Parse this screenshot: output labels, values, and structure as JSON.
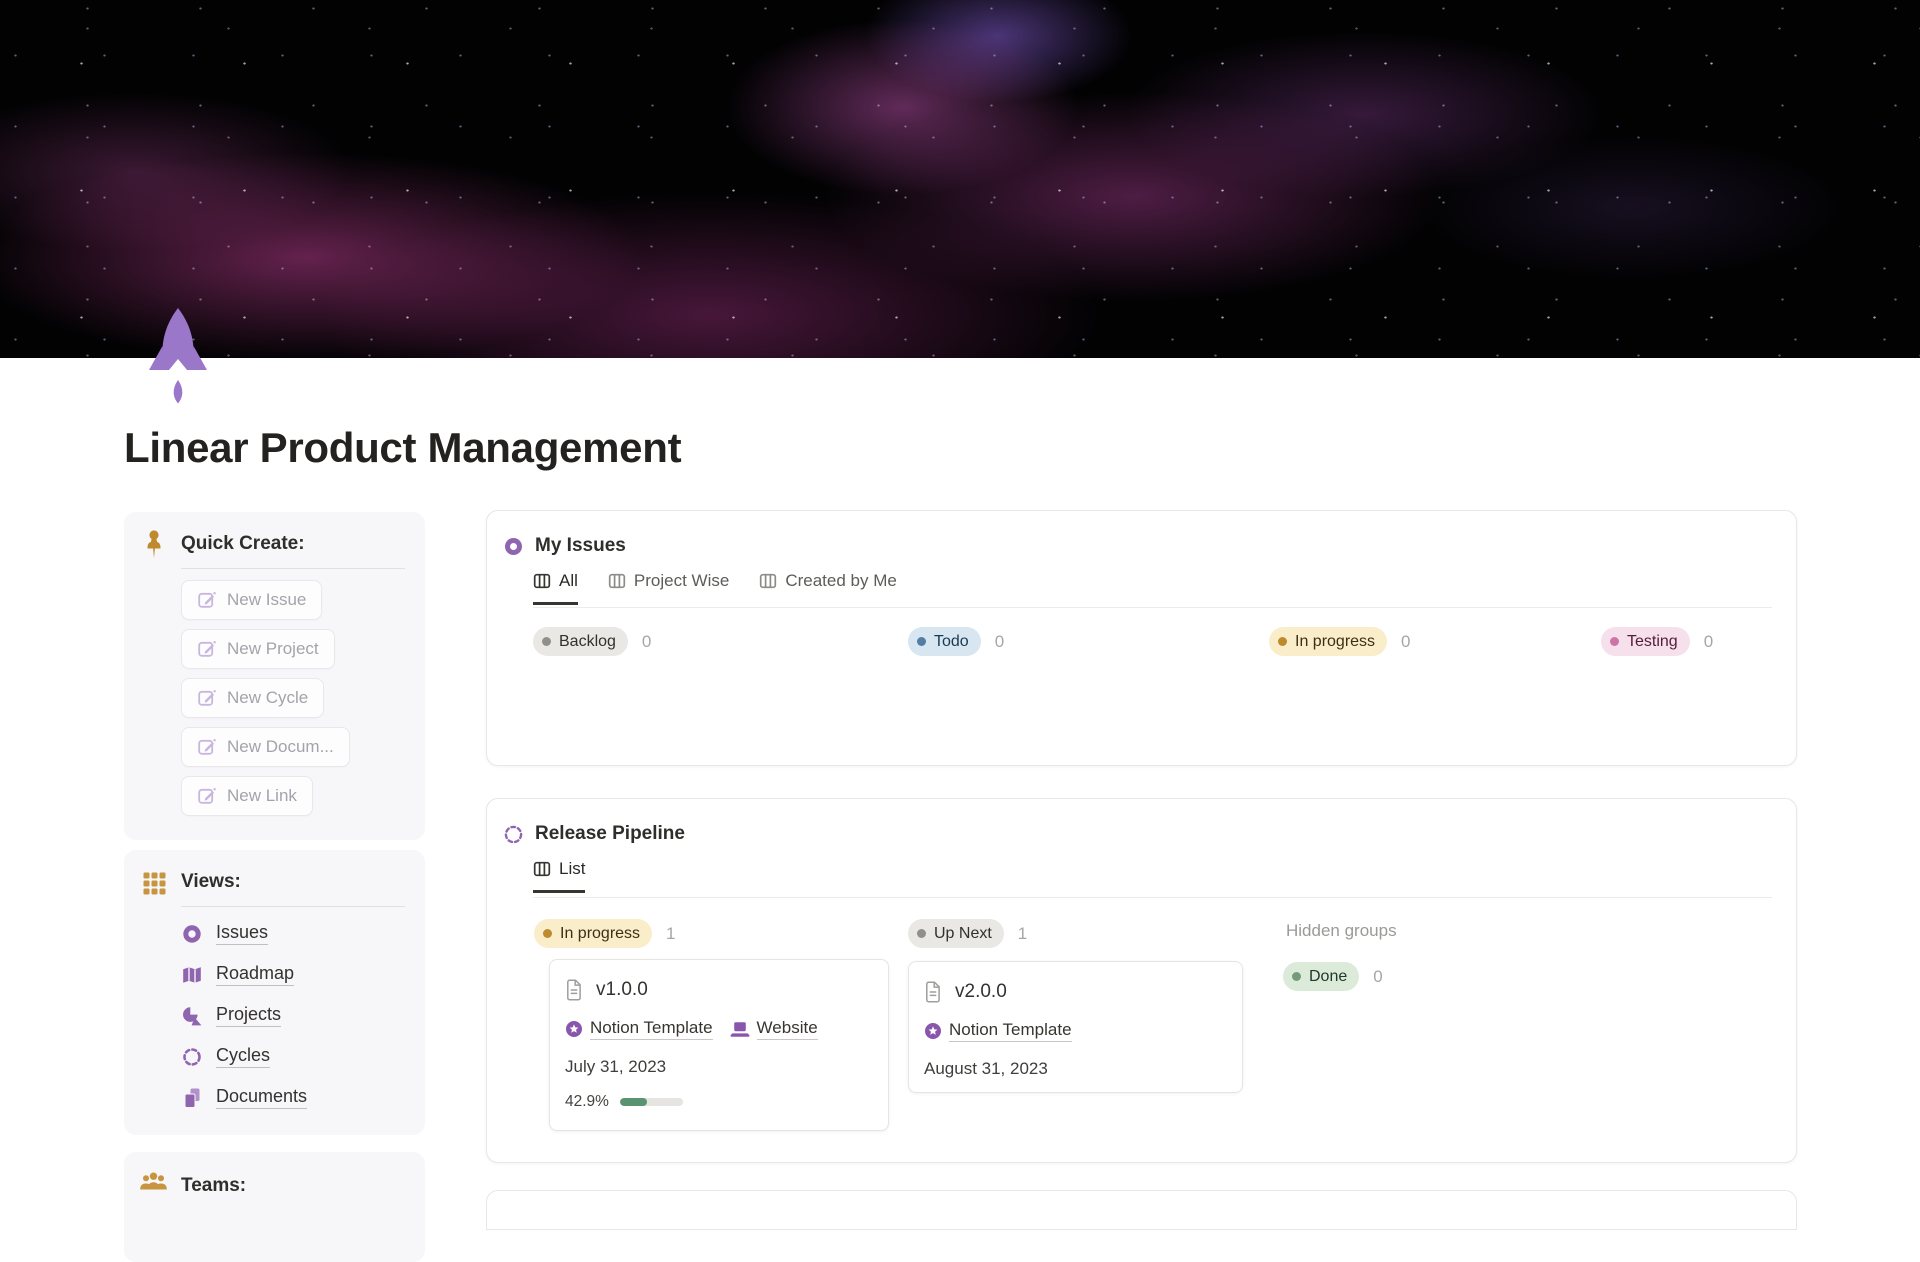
{
  "page": {
    "title": "Linear Product Management",
    "icon": "rocket-icon"
  },
  "sidebar": {
    "quick_create": {
      "heading": "Quick Create:",
      "icon": "pushpin-icon",
      "buttons": [
        {
          "label": "New Issue",
          "icon": "compose-icon"
        },
        {
          "label": "New Project",
          "icon": "compose-icon"
        },
        {
          "label": "New Cycle",
          "icon": "compose-icon"
        },
        {
          "label": "New Docum...",
          "icon": "compose-icon"
        },
        {
          "label": "New Link",
          "icon": "compose-icon"
        }
      ]
    },
    "views": {
      "heading": "Views:",
      "icon": "grid-icon",
      "items": [
        {
          "label": "Issues",
          "icon": "issues-donut-icon"
        },
        {
          "label": "Roadmap",
          "icon": "roadmap-map-icon"
        },
        {
          "label": "Projects",
          "icon": "projects-shapes-icon"
        },
        {
          "label": "Cycles",
          "icon": "cycles-dashed-circle-icon"
        },
        {
          "label": "Documents",
          "icon": "documents-pages-icon"
        }
      ]
    },
    "teams": {
      "heading": "Teams:",
      "icon": "people-icon"
    }
  },
  "my_issues": {
    "title": "My Issues",
    "icon": "donut-icon",
    "tabs": [
      {
        "label": "All",
        "active": true,
        "icon": "board-view-icon"
      },
      {
        "label": "Project Wise",
        "active": false,
        "icon": "board-view-icon"
      },
      {
        "label": "Created by Me",
        "active": false,
        "icon": "board-view-icon"
      }
    ],
    "groups": [
      {
        "label": "Backlog",
        "count": "0",
        "color": "gray"
      },
      {
        "label": "Todo",
        "count": "0",
        "color": "blue"
      },
      {
        "label": "In progress",
        "count": "0",
        "color": "yellow"
      },
      {
        "label": "Testing",
        "count": "0",
        "color": "pink"
      }
    ]
  },
  "release_pipeline": {
    "title": "Release Pipeline",
    "icon": "dashed-circle-icon",
    "tabs": [
      {
        "label": "List",
        "active": true,
        "icon": "board-view-icon"
      }
    ],
    "groups": [
      {
        "label": "In progress",
        "count": "1",
        "color": "yellow"
      },
      {
        "label": "Up Next",
        "count": "1",
        "color": "gray"
      }
    ],
    "hidden_groups_label": "Hidden groups",
    "hidden_group": {
      "label": "Done",
      "count": "0",
      "color": "green"
    },
    "cards": [
      {
        "title": "v1.0.0",
        "icon": "page-icon",
        "links": [
          {
            "label": "Notion Template",
            "icon": "circled-star-icon"
          },
          {
            "label": "Website",
            "icon": "laptop-icon"
          }
        ],
        "date": "July 31, 2023",
        "progress_label": "42.9%",
        "progress_pct": 42.9
      },
      {
        "title": "v2.0.0",
        "icon": "page-icon",
        "links": [
          {
            "label": "Notion Template",
            "icon": "circled-star-icon"
          }
        ],
        "date": "August 31, 2023"
      }
    ]
  },
  "colors": {
    "accent_purple": "#9065b0",
    "rocket_purple": "#9b77c9",
    "icon_gold": "#c08a2e",
    "progress_green": "#5a9370",
    "pill_gray_bg": "#e9e8e5",
    "pill_blue_bg": "#d7e6f1",
    "pill_yellow_bg": "#faedca",
    "pill_pink_bg": "#f6e0ec",
    "pill_green_bg": "#dcead9",
    "banner_magenta": "#db48a8"
  }
}
